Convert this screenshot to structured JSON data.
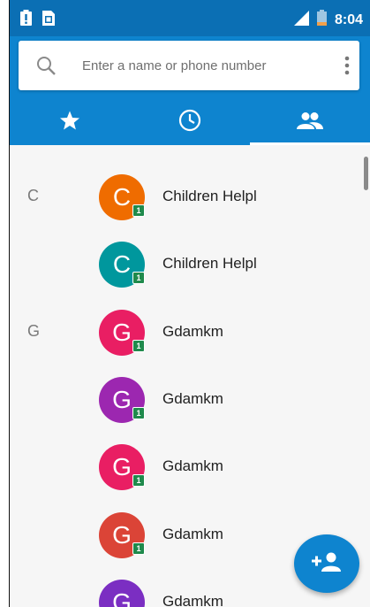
{
  "status_bar": {
    "time": "8:04",
    "icons": [
      "alert-icon",
      "sim-card-icon",
      "signal-icon",
      "battery-icon"
    ],
    "color": "#0b6fb4"
  },
  "search": {
    "placeholder": "Enter a name or phone number",
    "value": ""
  },
  "tabs": [
    {
      "name": "favorites",
      "icon": "star-icon",
      "selected": false
    },
    {
      "name": "recents",
      "icon": "clock-icon",
      "selected": false
    },
    {
      "name": "contacts",
      "icon": "people-icon",
      "selected": true
    }
  ],
  "contacts": [
    {
      "section": "C",
      "initial": "C",
      "name": "Children Helpl",
      "color": "#ef6c00"
    },
    {
      "section": "",
      "initial": "C",
      "name": "Children Helpl",
      "color": "#00979d"
    },
    {
      "section": "G",
      "initial": "G",
      "name": "Gdamkm",
      "color": "#e91e63"
    },
    {
      "section": "",
      "initial": "G",
      "name": "Gdamkm",
      "color": "#9c27b0"
    },
    {
      "section": "",
      "initial": "G",
      "name": "Gdamkm",
      "color": "#e91e63"
    },
    {
      "section": "",
      "initial": "G",
      "name": "Gdamkm",
      "color": "#db4437"
    },
    {
      "section": "",
      "initial": "G",
      "name": "Gdamkm",
      "color": "#7b2ec2"
    }
  ],
  "sim_badge": "1",
  "fab": {
    "icon": "add-person-icon"
  },
  "colors": {
    "accent": "#0e84cf",
    "header": "#0e84cf"
  }
}
